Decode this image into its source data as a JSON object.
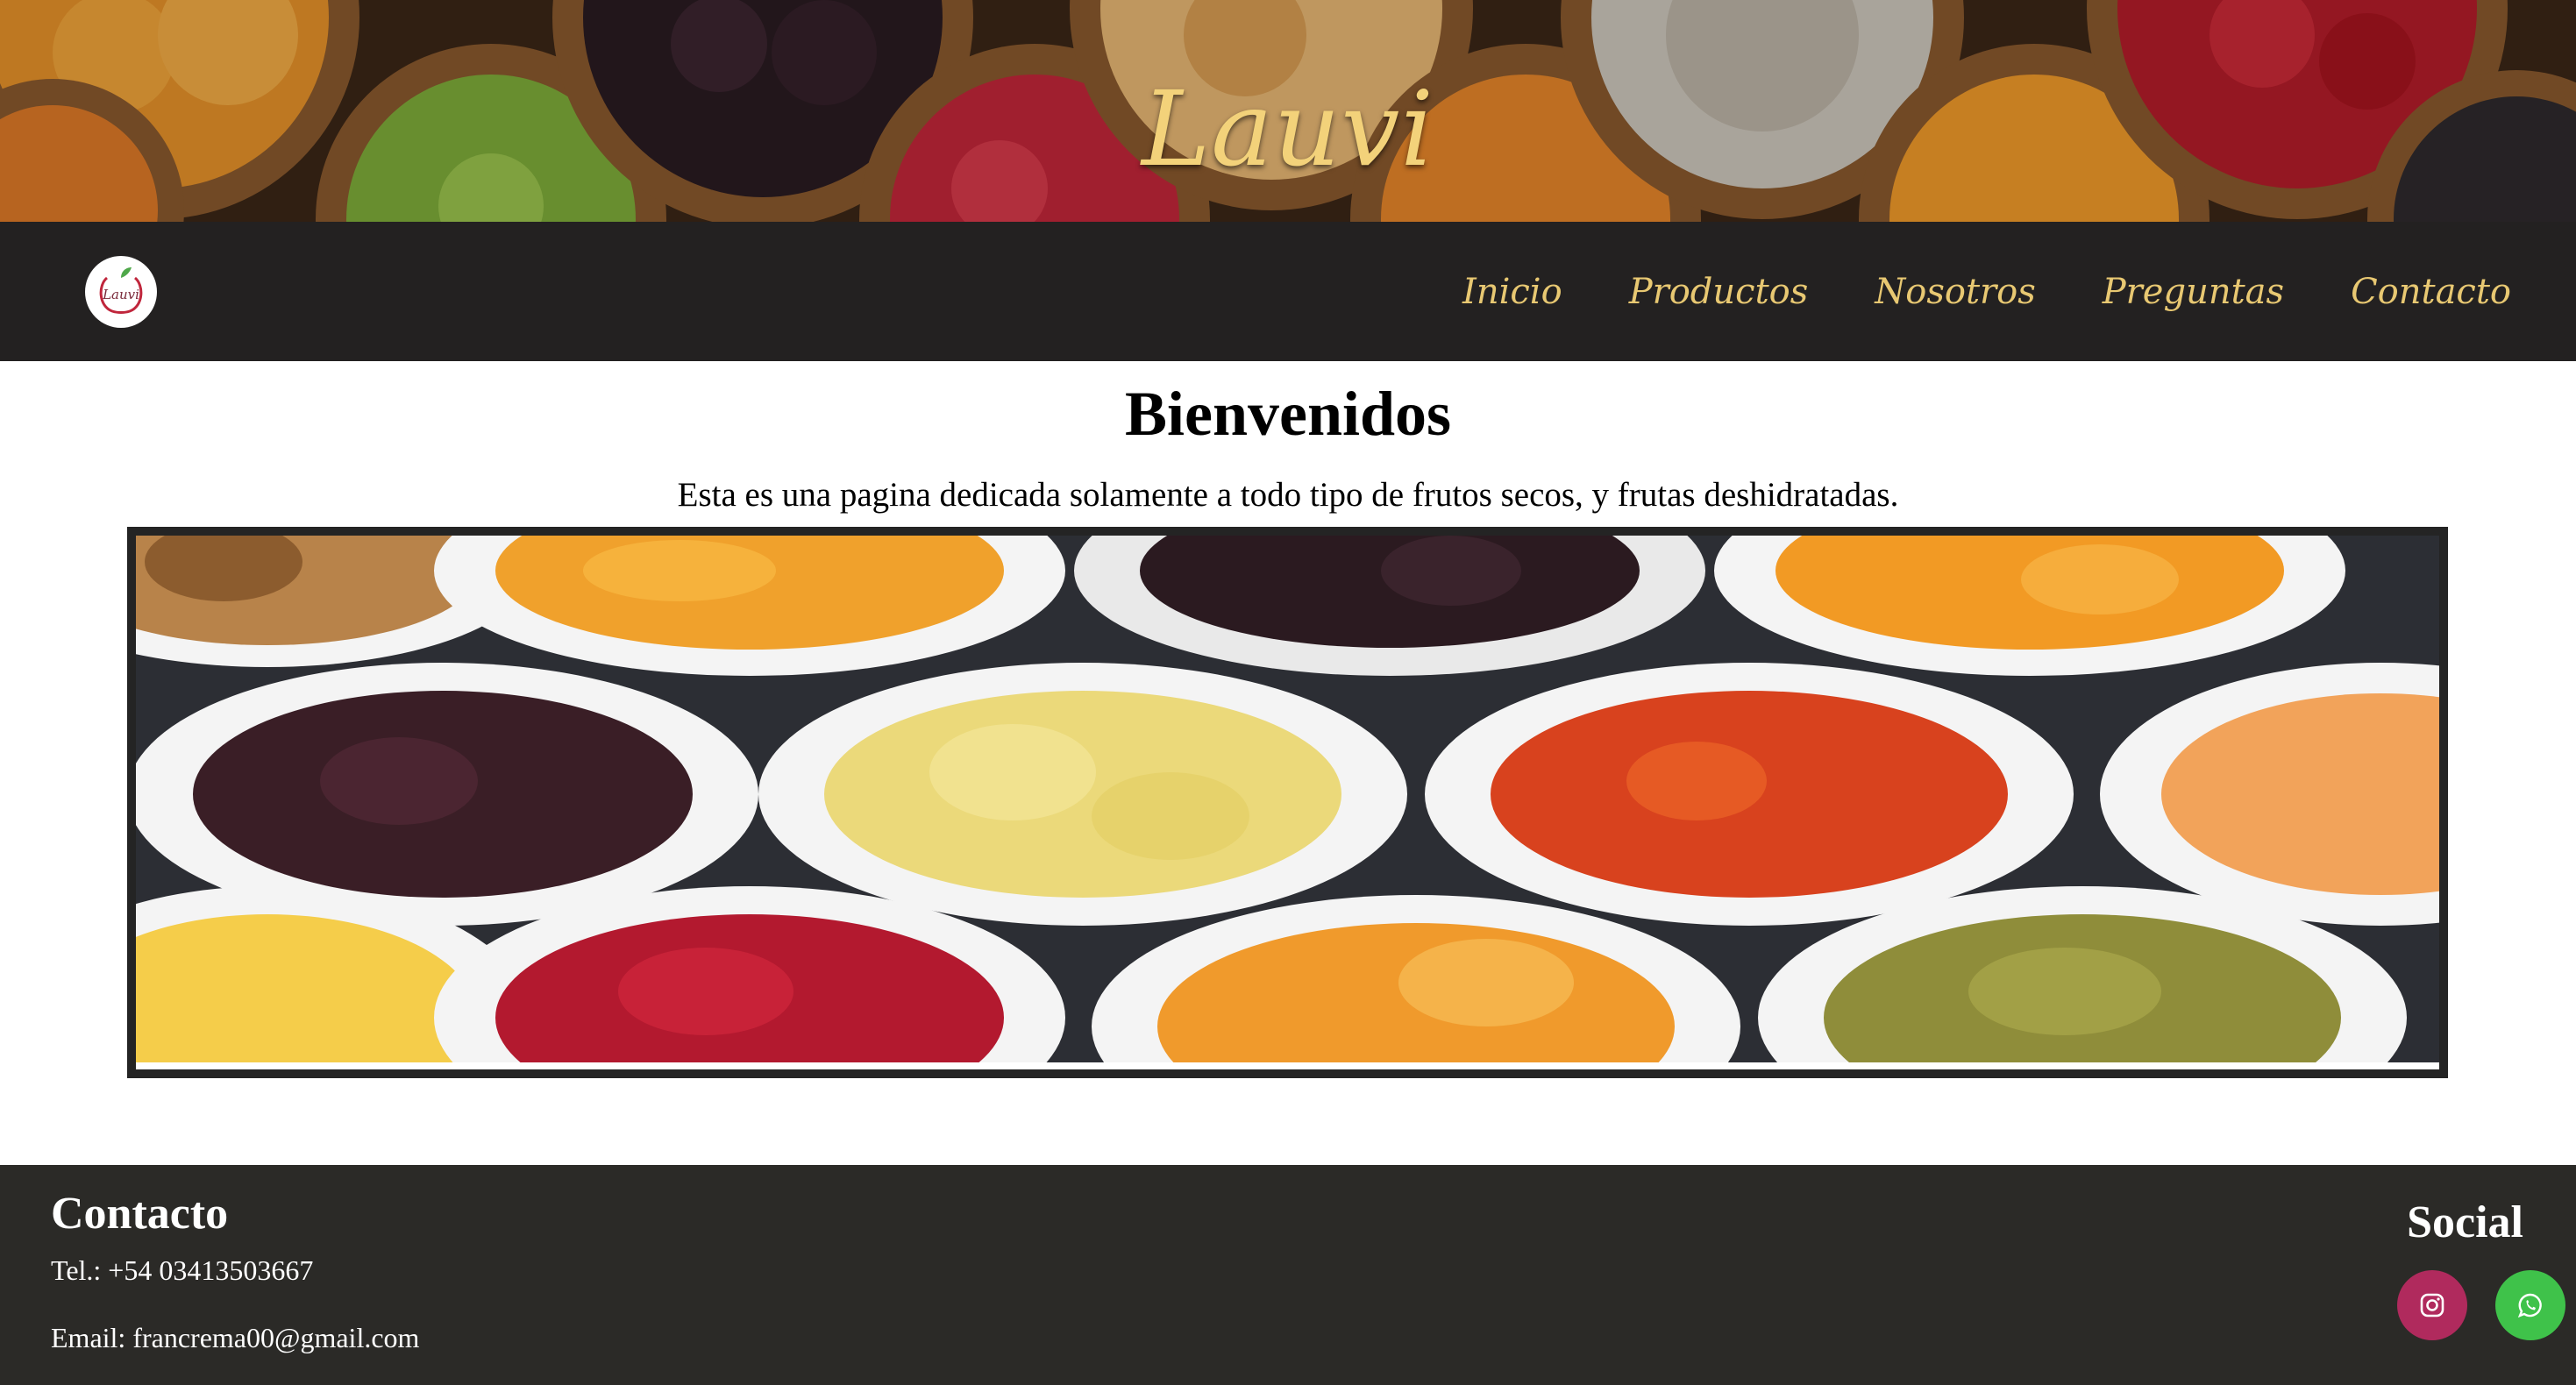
{
  "hero": {
    "brand": "Lauvi"
  },
  "navbar": {
    "logo_text": "Lauvi",
    "links": [
      {
        "label": "Inicio"
      },
      {
        "label": "Productos"
      },
      {
        "label": "Nosotros"
      },
      {
        "label": "Preguntas"
      },
      {
        "label": "Contacto"
      }
    ]
  },
  "main": {
    "title": "Bienvenidos",
    "description": "Esta es una pagina dedicada solamente a todo tipo de frutos secos, y frutas deshidratadas.",
    "banner_image": "dried-fruits-plates-photo"
  },
  "footer": {
    "contact_title": "Contacto",
    "phone": "Tel.: +54 03413503667",
    "email": "Email: francrema00@gmail.com",
    "social_title": "Social",
    "social": [
      {
        "icon": "instagram-icon",
        "color": "#b02a5d"
      },
      {
        "icon": "whatsapp-icon",
        "color": "#3fc24a"
      }
    ]
  },
  "colors": {
    "nav_background": "#232121",
    "nav_link": "#e8c872",
    "footer_background": "#2b2a27",
    "brand_gold": "#f3d27a"
  }
}
